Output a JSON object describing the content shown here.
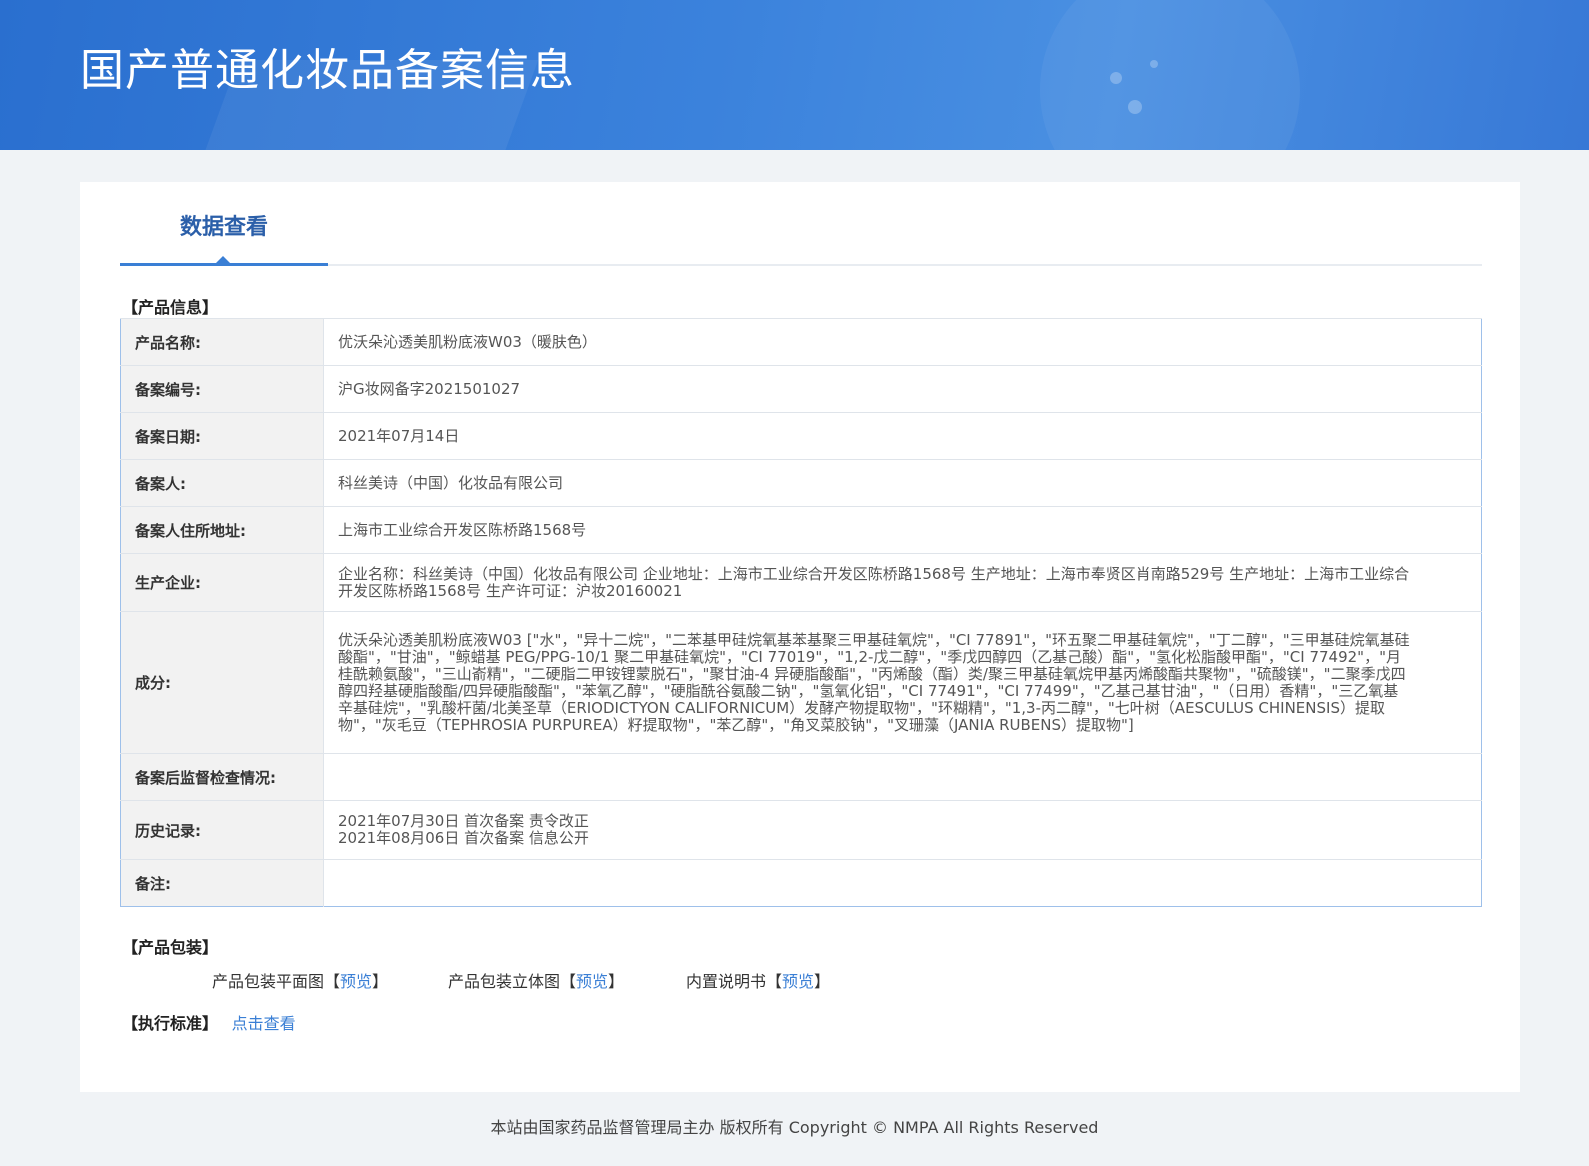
{
  "header": {
    "title": "国产普通化妆品备案信息"
  },
  "tab": {
    "label": "数据查看"
  },
  "product_info": {
    "section_title": "【产品信息】",
    "rows": [
      {
        "label": "产品名称:",
        "value": "优沃朵沁透美肌粉底液W03（暖肤色）"
      },
      {
        "label": "备案编号:",
        "value": "沪G妆网备字2021501027"
      },
      {
        "label": "备案日期:",
        "value": "2021年07月14日"
      },
      {
        "label": "备案人:",
        "value": "科丝美诗（中国）化妆品有限公司"
      },
      {
        "label": "备案人住所地址:",
        "value": "上海市工业综合开发区陈桥路1568号"
      },
      {
        "label": "生产企业:",
        "value": "企业名称：科丝美诗（中国）化妆品有限公司 企业地址：上海市工业综合开发区陈桥路1568号 生产地址：上海市奉贤区肖南路529号 生产地址：上海市工业综合开发区陈桥路1568号 生产许可证：沪妆20160021"
      },
      {
        "label": "成分:",
        "value": "优沃朵沁透美肌粉底液W03 [\"水\"，\"异十二烷\"，\"二苯基甲硅烷氧基苯基聚三甲基硅氧烷\"，\"CI 77891\"，\"环五聚二甲基硅氧烷\"，\"丁二醇\"，\"三甲基硅烷氧基硅酸酯\"，\"甘油\"，\"鲸蜡基 PEG/PPG-10/1 聚二甲基硅氧烷\"，\"CI 77019\"，\"1,2-戊二醇\"，\"季戊四醇四（乙基己酸）酯\"，\"氢化松脂酸甲酯\"，\"CI 77492\"，\"月桂酰赖氨酸\"，\"三山嵛精\"，\"二硬脂二甲铵锂蒙脱石\"，\"聚甘油-4 异硬脂酸酯\"，\"丙烯酸（酯）类/聚三甲基硅氧烷甲基丙烯酸酯共聚物\"，\"硫酸镁\"，\"二聚季戊四醇四羟基硬脂酸酯/四异硬脂酸酯\"，\"苯氧乙醇\"，\"硬脂酰谷氨酸二钠\"，\"氢氧化铝\"，\"CI 77491\"，\"CI 77499\"，\"乙基己基甘油\"，\"（日用）香精\"，\"三乙氧基辛基硅烷\"，\"乳酸杆菌/北美圣草（ERIODICTYON CALIFORNICUM）发酵产物提取物\"，\"环糊精\"，\"1,3-丙二醇\"，\"七叶树（AESCULUS CHINENSIS）提取物\"，\"灰毛豆（TEPHROSIA PURPUREA）籽提取物\"，\"苯乙醇\"，\"角叉菜胶钠\"，\"叉珊藻（JANIA RUBENS）提取物\"]"
      },
      {
        "label": "备案后监督检查情况:",
        "value": ""
      },
      {
        "label": "历史记录:",
        "value": "",
        "lines": [
          "2021年07月30日 首次备案 责令改正",
          "2021年08月06日 首次备案 信息公开"
        ]
      },
      {
        "label": "备注:",
        "value": ""
      }
    ]
  },
  "packaging": {
    "section_title": "【产品包装】",
    "items": [
      {
        "label": "产品包装平面图",
        "bracket_open": "【",
        "link": "预览",
        "bracket_close": "】"
      },
      {
        "label": "产品包装立体图",
        "bracket_open": "【",
        "link": "预览",
        "bracket_close": "】"
      },
      {
        "label": "内置说明书",
        "bracket_open": "【",
        "link": "预览",
        "bracket_close": "】"
      }
    ]
  },
  "standard": {
    "section_title": "【执行标准】",
    "link": "点击查看"
  },
  "footer": {
    "text": "本站由国家药品监督管理局主办 版权所有 Copyright © NMPA All Rights Reserved"
  }
}
